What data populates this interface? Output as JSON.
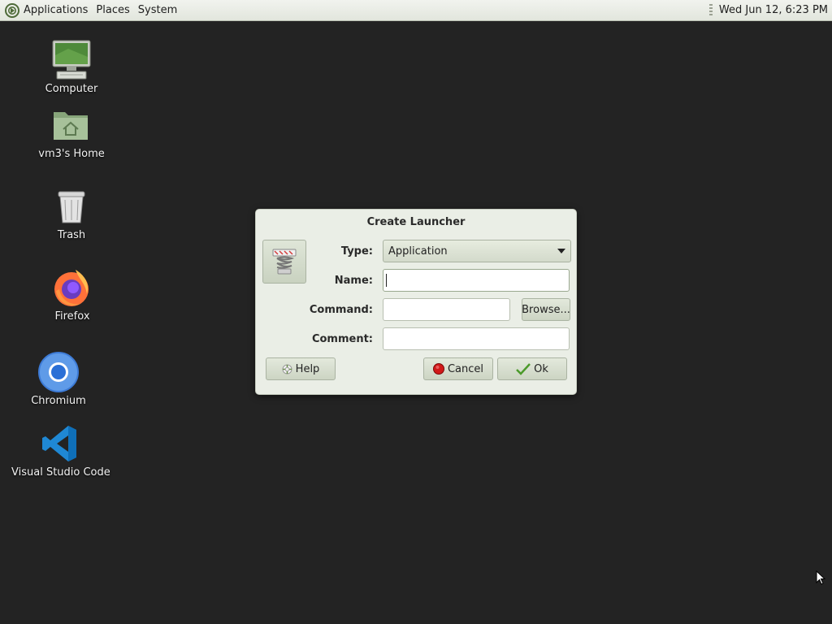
{
  "top_panel": {
    "menus": [
      {
        "label": "Applications"
      },
      {
        "label": "Places"
      },
      {
        "label": "System"
      }
    ],
    "clock": "Wed Jun 12,  6:23 PM"
  },
  "desktop": {
    "icons": [
      {
        "label": "Computer",
        "icon": "computer-icon"
      },
      {
        "label": "vm3's Home",
        "icon": "home-folder-icon"
      },
      {
        "label": "Trash",
        "icon": "trash-icon"
      },
      {
        "label": "Firefox",
        "icon": "firefox-icon"
      },
      {
        "label": "Chromium",
        "icon": "chromium-icon"
      },
      {
        "label": "Visual Studio Code",
        "icon": "vscode-icon"
      }
    ]
  },
  "dialog": {
    "title": "Create Launcher",
    "type_label": "Type:",
    "type_value": "Application",
    "name_label": "Name:",
    "name_value": "",
    "command_label": "Command:",
    "command_value": "",
    "comment_label": "Comment:",
    "comment_value": "",
    "browse_label": "Browse...",
    "help_label": "Help",
    "cancel_label": "Cancel",
    "ok_label": "Ok"
  },
  "colors": {
    "desktop_bg": "#232323",
    "panel_bg": "#e6e9e2",
    "dialog_bg": "#eaeee6",
    "accent_green": "#6b8f4e"
  }
}
